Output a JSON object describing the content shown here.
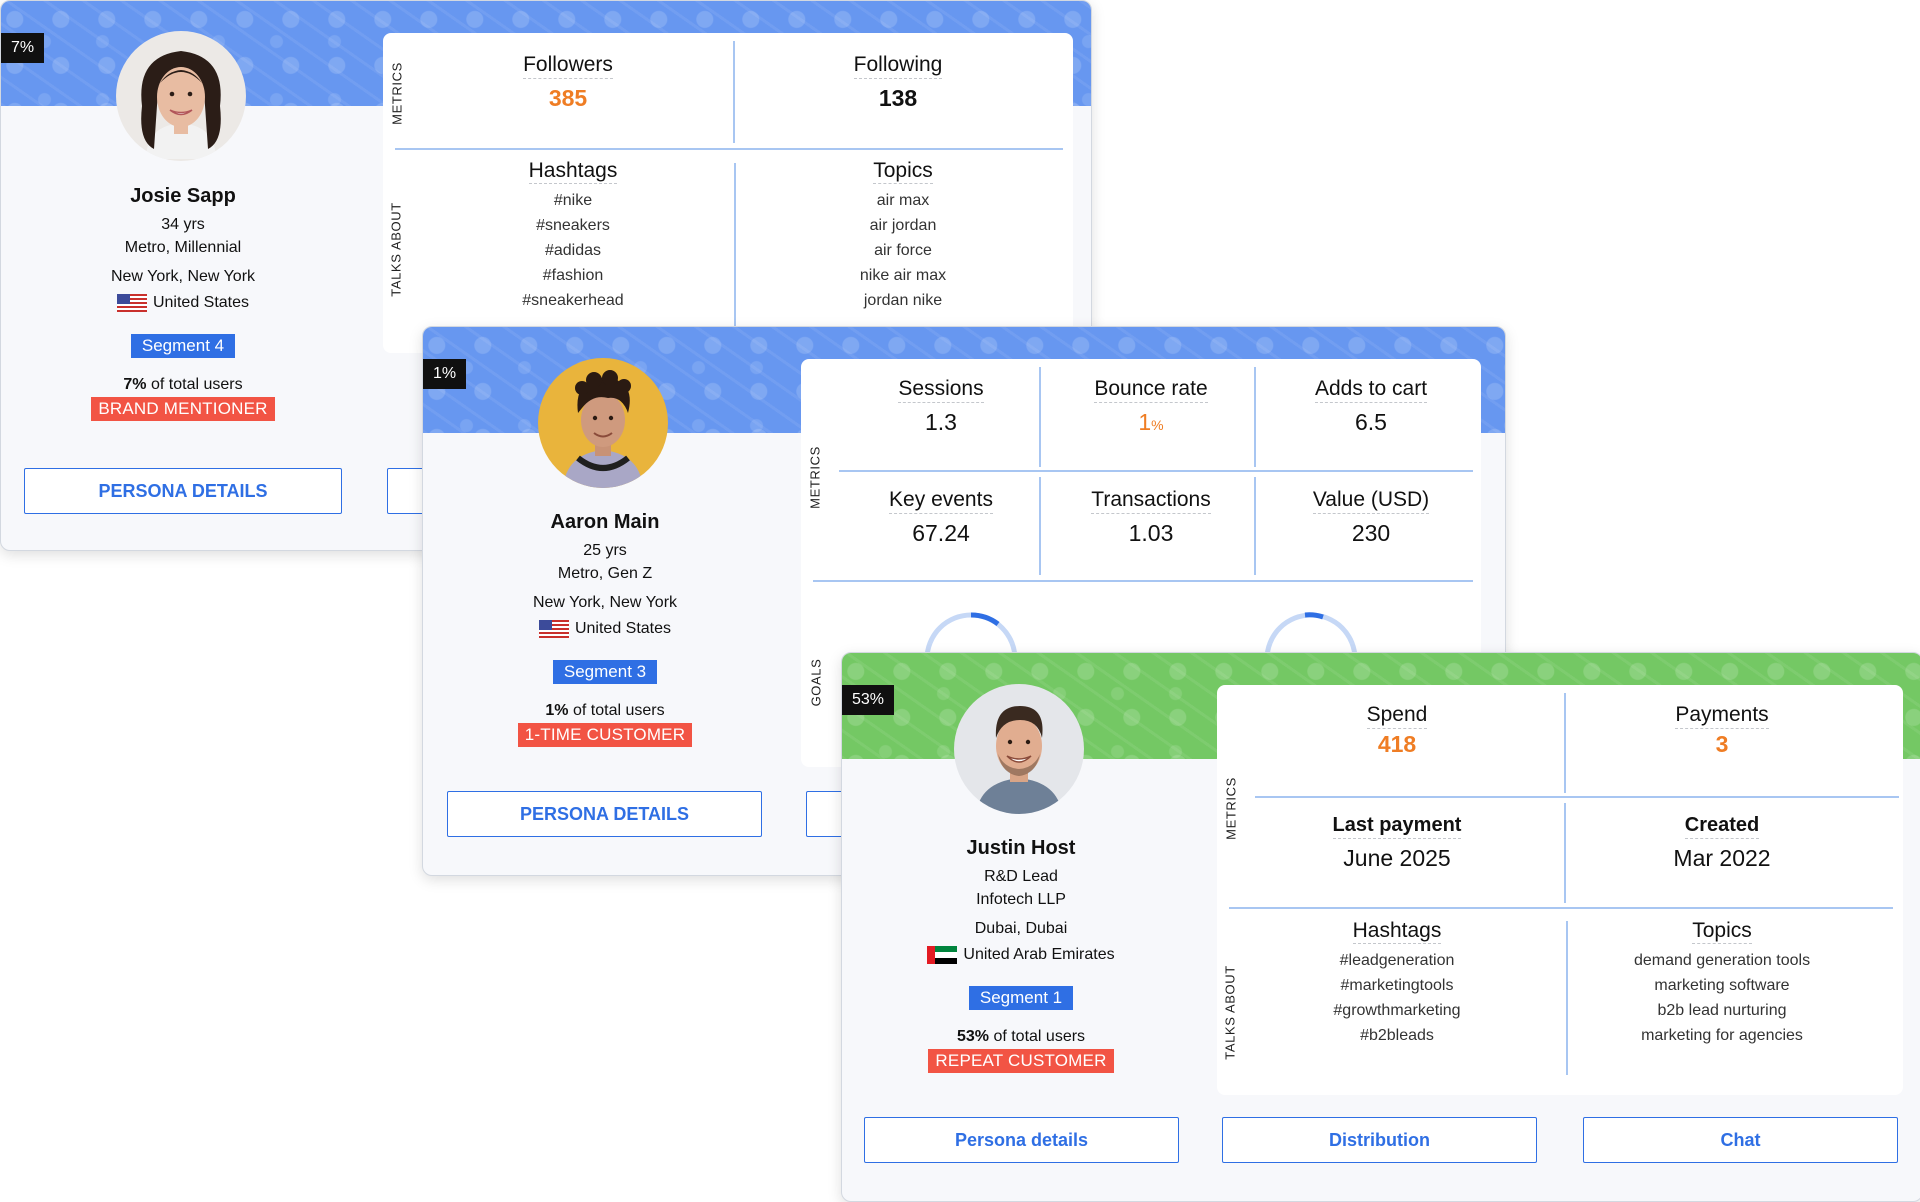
{
  "card1": {
    "percent_badge": "7%",
    "name": "Josie Sapp",
    "age": "34 yrs",
    "demographic": "Metro, Millennial",
    "location": "New York, New York",
    "country": "United States",
    "segment": "Segment 4",
    "share_value": "7%",
    "share_suffix": "of total users",
    "persona_tag": "BRAND MENTIONER",
    "button_label": "PERSONA DETAILS",
    "metrics_label": "METRICS",
    "talks_label": "TALKS ABOUT",
    "metrics": [
      {
        "label": "Followers",
        "value": "385"
      },
      {
        "label": "Following",
        "value": "138"
      }
    ],
    "hashtags_title": "Hashtags",
    "hashtags": [
      "#nike",
      "#sneakers",
      "#adidas",
      "#fashion",
      "#sneakerhead"
    ],
    "topics_title": "Topics",
    "topics": [
      "air max",
      "air jordan",
      "air force",
      "nike air max",
      "jordan nike"
    ]
  },
  "card2": {
    "percent_badge": "1%",
    "name": "Aaron Main",
    "age": "25 yrs",
    "demographic": "Metro, Gen Z",
    "location": "New York, New York",
    "country": "United States",
    "segment": "Segment 3",
    "share_value": "1%",
    "share_suffix": "of total users",
    "persona_tag": "1-TIME CUSTOMER",
    "button_label": "PERSONA DETAILS",
    "metrics_label": "METRICS",
    "goals_label": "GOALS",
    "metrics": [
      {
        "label": "Sessions",
        "value": "1.3"
      },
      {
        "label": "Bounce rate",
        "value": "1",
        "unit": "%"
      },
      {
        "label": "Adds to cart",
        "value": "6.5"
      },
      {
        "label": "Key events",
        "value": "67.24"
      },
      {
        "label": "Transactions",
        "value": "1.03"
      },
      {
        "label": "Value (USD)",
        "value": "230"
      }
    ]
  },
  "card3": {
    "percent_badge": "53%",
    "name": "Justin Host",
    "role": "R&D Lead",
    "company": "Infotech LLP",
    "location": "Dubai, Dubai",
    "country": "United Arab Emirates",
    "segment": "Segment 1",
    "share_value": "53%",
    "share_suffix": "of total users",
    "persona_tag": "REPEAT CUSTOMER",
    "metrics_label": "METRICS",
    "talks_label": "TALKS ABOUT",
    "metrics": [
      {
        "label": "Spend",
        "value": "418"
      },
      {
        "label": "Payments",
        "value": "3"
      },
      {
        "label": "Last payment",
        "value": "June 2025"
      },
      {
        "label": "Created",
        "value": "Mar 2022"
      }
    ],
    "hashtags_title": "Hashtags",
    "hashtags": [
      "#leadgeneration",
      "#marketingtools",
      "#growthmarketing",
      "#b2bleads"
    ],
    "topics_title": "Topics",
    "topics": [
      "demand generation tools",
      "marketing software",
      "b2b lead nurturing",
      "marketing for agencies"
    ],
    "buttons": [
      "Persona details",
      "Distribution",
      "Chat"
    ]
  },
  "colors": {
    "accent_blue": "#2f6fe4",
    "banner_blue": "#6797f0",
    "banner_green": "#74c864",
    "tag_red": "#f25444",
    "highlight_orange": "#ef7d24",
    "divider_blue": "#a8c6f2"
  },
  "icons": [
    "avatar-woman",
    "avatar-young-man",
    "avatar-man",
    "us-flag-icon",
    "uae-flag-icon"
  ]
}
